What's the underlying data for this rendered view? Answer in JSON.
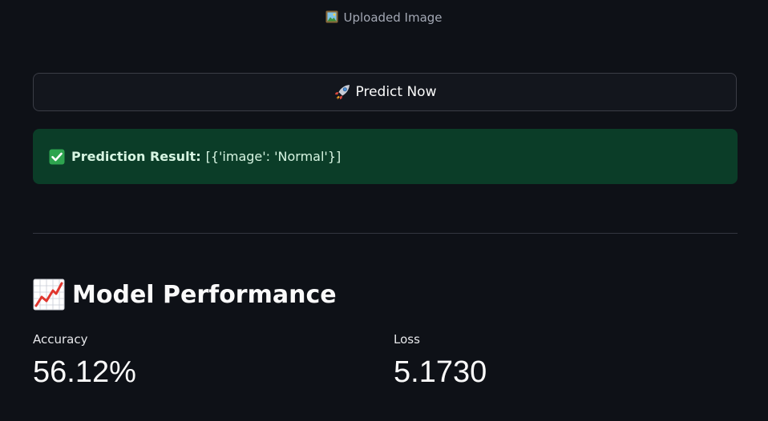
{
  "image_caption": {
    "icon": "framed-picture-icon",
    "text": "Uploaded Image"
  },
  "predict_button": {
    "icon": "rocket-icon",
    "label": "Predict Now"
  },
  "prediction": {
    "icon": "check-mark-icon",
    "label": "Prediction Result:",
    "value": "[{'image': 'Normal'}]",
    "accent": "#0b3d28"
  },
  "performance": {
    "icon": "chart-increasing-icon",
    "title": "Model Performance",
    "metrics": [
      {
        "label": "Accuracy",
        "value": "56.12%"
      },
      {
        "label": "Loss",
        "value": "5.1730"
      }
    ]
  },
  "colors": {
    "background": "#0e1117",
    "text": "#fafafa",
    "success_bg": "#0b3d28",
    "success_check": "#2ea44f"
  }
}
